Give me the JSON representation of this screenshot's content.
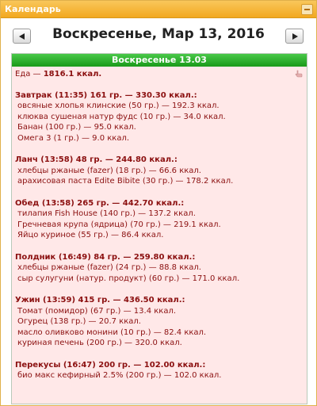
{
  "widget": {
    "title": "Календарь"
  },
  "nav": {
    "date_title": "Воскресенье, Мар 13, 2016"
  },
  "day": {
    "header": "Воскресенье 13.03",
    "total_label": "Еда — ",
    "total_value": "1816.1 ккал.",
    "meals": [
      {
        "head": "Завтрак (11:35) 161 гр. — 330.30 ккал.:",
        "items": [
          "овсяные хлопья клинские (50 гр.) — 192.3 ккал.",
          "клюква сушеная натур фудс (10 гр.) — 34.0 ккал.",
          "Банан (100 гр.) — 95.0 ккал.",
          "Омега 3 (1 гр.) — 9.0 ккал."
        ]
      },
      {
        "head": "Ланч (13:58) 48 гр. — 244.80 ккал.:",
        "items": [
          "хлебцы ржаные (fazer) (18 гр.) — 66.6 ккал.",
          "арахисовая паста Edite Bibite (30 гр.) — 178.2 ккал."
        ]
      },
      {
        "head": "Обед (13:58) 265 гр. — 442.70 ккал.:",
        "items": [
          "тилапия Fish House (140 гр.) — 137.2 ккал.",
          "Гречневая крупа (ядрица) (70 гр.) — 219.1 ккал.",
          "Яйцо куриное (55 гр.) — 86.4 ккал."
        ]
      },
      {
        "head": "Полдник (16:49) 84 гр. — 259.80 ккал.:",
        "items": [
          "хлебцы ржаные (fazer) (24 гр.) — 88.8 ккал.",
          "сыр сулугуни (натур. продукт) (60 гр.) — 171.0 ккал."
        ]
      },
      {
        "head": "Ужин (13:59) 415 гр. — 436.50 ккал.:",
        "items": [
          "Томат (помидор) (67 гр.) — 13.4 ккал.",
          "Огурец (138 гр.) — 20.7 ккал.",
          "масло оливково монини (10 гр.) — 82.4 ккал.",
          "куриная печень (200 гр.) — 320.0 ккал."
        ]
      },
      {
        "head": "Перекусы (16:47) 200 гр. — 102.00 ккал.:",
        "items": [
          "био макс кефирный 2.5% (200 гр.) — 102.0 ккал."
        ]
      }
    ]
  }
}
